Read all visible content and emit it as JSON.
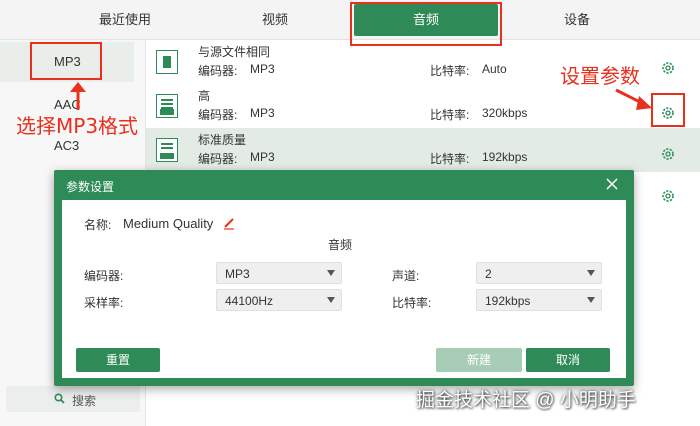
{
  "tabs": [
    {
      "label": "最近使用",
      "active": false
    },
    {
      "label": "视频",
      "active": false
    },
    {
      "label": "音频",
      "active": true
    },
    {
      "label": "设备",
      "active": false
    }
  ],
  "formats": [
    {
      "label": "MP3",
      "selected": true
    },
    {
      "label": "AAC",
      "selected": false
    },
    {
      "label": "AC3",
      "selected": false
    }
  ],
  "left_search": {
    "icon": "search-icon",
    "label": "搜索"
  },
  "presets": [
    {
      "name": "与源文件相同",
      "encoder_label": "编码器:",
      "encoder": "MP3",
      "bitrate_label": "比特率:",
      "bitrate": "Auto",
      "highlighted": false
    },
    {
      "name": "高",
      "encoder_label": "编码器:",
      "encoder": "MP3",
      "bitrate_label": "比特率:",
      "bitrate": "320kbps",
      "highlighted": false
    },
    {
      "name": "标准质量",
      "encoder_label": "编码器:",
      "encoder": "MP3",
      "bitrate_label": "比特率:",
      "bitrate": "192kbps",
      "highlighted": true
    }
  ],
  "annotations": {
    "select_format": "选择MP3格式",
    "set_params": "设置参数",
    "color": "#e8301c"
  },
  "dialog": {
    "title": "参数设置",
    "name_label": "名称:",
    "name_value": "Medium Quality",
    "section_label": "音频",
    "encoder_label": "编码器:",
    "encoder_value": "MP3",
    "channel_label": "声道:",
    "channel_value": "2",
    "samplerate_label": "采样率:",
    "samplerate_value": "44100Hz",
    "bitrate_label": "比特率:",
    "bitrate_value": "192kbps",
    "reset_button": "重置",
    "new_button": "新建",
    "cancel_button": "取消"
  },
  "watermark": "掘金技术社区 @ 小明助手",
  "colors": {
    "accent": "#2e8b57",
    "annotation": "#e8301c"
  }
}
